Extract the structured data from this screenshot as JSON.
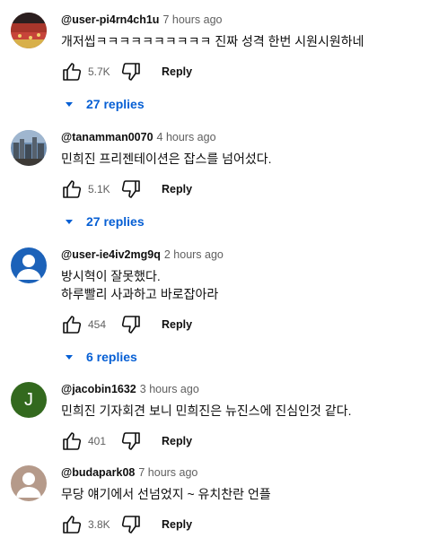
{
  "comments": [
    {
      "handle": "@user-pi4rn4ch1u",
      "time": "7 hours ago",
      "text": [
        "개저씹ㅋㅋㅋㅋㅋㅋㅋㅋㅋㅋ 진짜 성격 한번 시원시원하네"
      ],
      "likes": "5.7K",
      "reply_label": "Reply",
      "replies_label": "27 replies",
      "avatar_icon": "photo-crowd-red"
    },
    {
      "handle": "@tanamman0070",
      "time": "4 hours ago",
      "text": [
        "민희진 프리젠테이션은 잡스를 넘어섰다."
      ],
      "likes": "5.1K",
      "reply_label": "Reply",
      "replies_label": "27 replies",
      "avatar_icon": "photo-city"
    },
    {
      "handle": "@user-ie4iv2mg9q",
      "time": "2 hours ago",
      "text": [
        "방시혁이 잘못했다.",
        "하루빨리 사과하고 바로잡아라"
      ],
      "likes": "454",
      "reply_label": "Reply",
      "replies_label": "6 replies",
      "avatar_icon": "default-person-icon"
    },
    {
      "handle": "@jacobin1632",
      "time": "3 hours ago",
      "text": [
        "민희진 기자회견 보니 민희진은 뉴진스에 진심인것 같다."
      ],
      "likes": "401",
      "reply_label": "Reply",
      "avatar_letter": "J",
      "avatar_icon": "letter-avatar"
    },
    {
      "handle": "@budapark08",
      "time": "7 hours ago",
      "text": [
        "무당 얘기에서 선넘었지 ~ 유치찬란 언플"
      ],
      "likes": "3.8K",
      "reply_label": "Reply",
      "avatar_icon": "default-person-icon"
    }
  ],
  "colors": {
    "link_blue": "#065fd4",
    "muted": "#606060",
    "letter_avatar_bg": "#33691e",
    "person_avatar_bg_blue": "#1c62b9",
    "person_avatar_bg_brown": "#b59a8a"
  }
}
